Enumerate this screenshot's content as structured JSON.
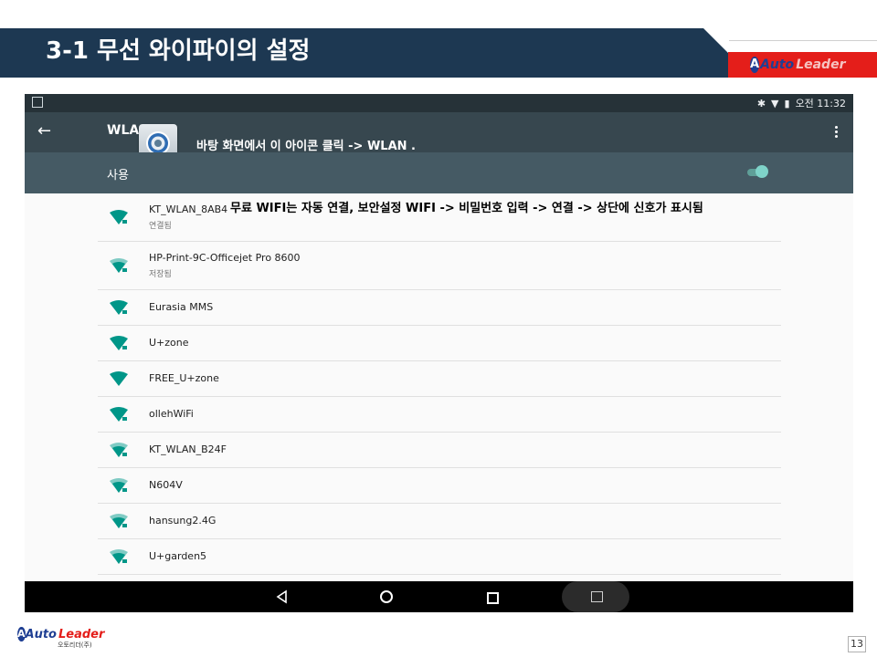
{
  "slide": {
    "title": "3-1 무선 와이파이의 설정",
    "page_number": "13",
    "logo": {
      "word1": "Auto",
      "word2": "Leader",
      "caption": "오토리더(주)"
    }
  },
  "device": {
    "status_bar": {
      "time": "오전 11:32"
    },
    "app_bar": {
      "title": "WLAN"
    },
    "use_row": {
      "label": "사용",
      "toggle_on": true
    },
    "networks": [
      {
        "ssid": "KT_WLAN_8AB4",
        "status": "연결됨"
      },
      {
        "ssid": "HP-Print-9C-Officejet Pro 8600",
        "status": "저장됨"
      },
      {
        "ssid": "Eurasia MMS"
      },
      {
        "ssid": "U+zone"
      },
      {
        "ssid": "FREE_U+zone"
      },
      {
        "ssid": "ollehWiFi"
      },
      {
        "ssid": "KT_WLAN_B24F"
      },
      {
        "ssid": "N604V"
      },
      {
        "ssid": "hansung2.4G"
      },
      {
        "ssid": "U+garden5"
      }
    ]
  },
  "annotations": {
    "step1": "바탕 화면에서 이 아이콘 클릭 -> WLAN .",
    "step2": "무료 WIFI는 자동 연결, 보안설정 WIFI -> 비밀번호 입력 -> 연결 -> 상단에 신호가 표시됨"
  },
  "colors": {
    "title_bar": "#1d3852",
    "logo_red": "#e41e1a",
    "wifi_teal": "#009688",
    "app_bar": "#37474f"
  }
}
